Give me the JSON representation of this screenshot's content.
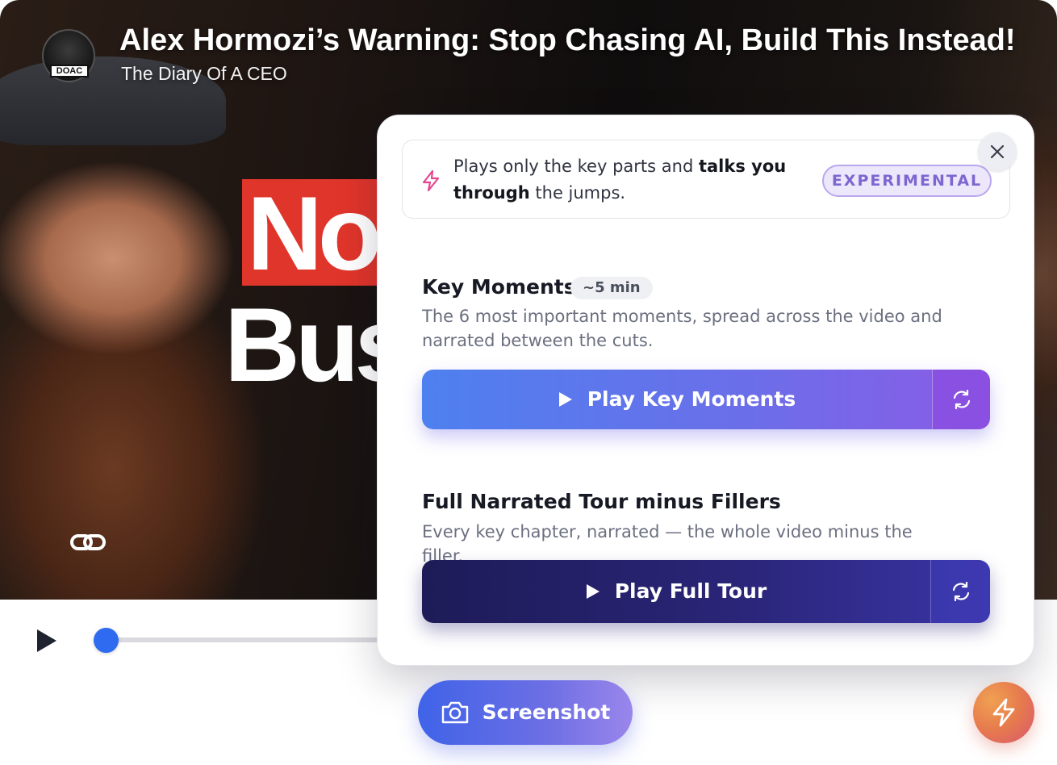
{
  "video": {
    "title": "Alex Hormozi’s Warning: Stop Chasing AI, Build This Instead!",
    "channel": "The Diary Of A CEO",
    "channel_badge": "DOAC",
    "thumbnail_text_top": "No",
    "thumbnail_text_bottom": "Bus"
  },
  "player": {
    "progress_fraction": 0.0
  },
  "panel": {
    "info_text_1": "Plays only the key parts and ",
    "info_text_bold_1": "talks you through",
    "info_text_2": " the jumps.",
    "badge": "EXPERIMENTAL",
    "key_moments": {
      "title": "Key Moments",
      "duration": "~5 min",
      "description": "The 6 most important moments, spread across the video and narrated between the cuts.",
      "button_label": "Play Key Moments"
    },
    "full_tour": {
      "title": "Full Narrated Tour minus Fillers",
      "description": "Every key chapter, narrated — the whole video minus the filler.",
      "button_label": "Play Full Tour"
    }
  },
  "bottom": {
    "screenshot_label": "Screenshot"
  },
  "colors": {
    "accent_blue": "#4e80ef",
    "accent_purple": "#8a5ce6",
    "tour_navy": "#1e1b58",
    "badge_purple": "#7b67cf",
    "fab_orange": "#e67a4e"
  },
  "icons": [
    "play-icon",
    "link-icon",
    "bolt-icon",
    "close-icon",
    "refresh-icon",
    "camera-icon"
  ]
}
